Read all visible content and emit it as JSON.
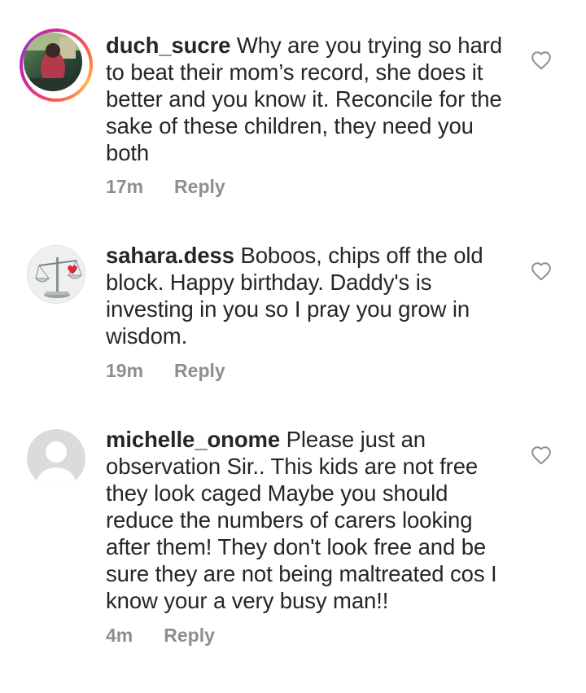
{
  "comments": [
    {
      "username": "duch_sucre",
      "text": " Why are you trying so hard to beat their mom’s record, she does it better and you know it. Reconcile for the sake of these children, they need you both",
      "time": "17m",
      "reply_label": "Reply",
      "avatar": "story-ring-photo",
      "like_icon": "heart-outline-icon"
    },
    {
      "username": "sahara.dess",
      "text": " Boboos, chips off the old block. Happy birthday. Daddy's is investing in you so I pray you grow in wisdom.",
      "time": "19m",
      "reply_label": "Reply",
      "avatar": "scales-heart-photo",
      "like_icon": "heart-outline-icon"
    },
    {
      "username": "michelle_onome",
      "text": " Please just an observation Sir.. This kids are not free they look caged Maybe you should reduce the numbers of carers looking after them! They don't look free and be sure they are not being maltreated cos I know your a very busy man!!",
      "time": "4m",
      "reply_label": "Reply",
      "avatar": "default-person-avatar",
      "like_icon": "heart-outline-icon"
    }
  ],
  "colors": {
    "text": "#262626",
    "meta": "#8e8e8e",
    "heart_outline": "#8e8e8e",
    "default_avatar_bg": "#dbdbdb"
  }
}
